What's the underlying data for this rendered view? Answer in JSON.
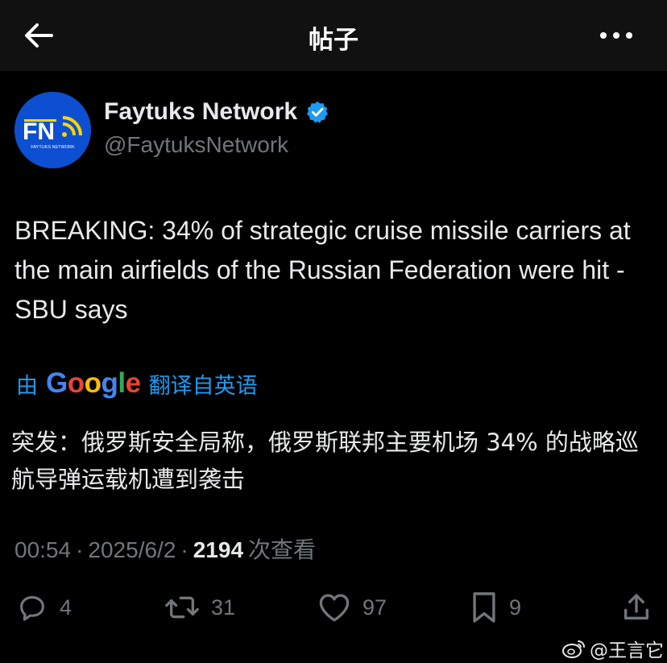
{
  "header": {
    "title": "帖子"
  },
  "author": {
    "name": "Faytuks Network",
    "handle": "@FaytuksNetwork",
    "avatar_logo_text": "FN",
    "avatar_sub_text": "FAYTUKS NETWORK",
    "verified": true
  },
  "post": {
    "text": "BREAKING: 34% of strategic cruise missile carriers at the main airfields of the Russian Federation were hit - SBU says",
    "translate_prefix": "由",
    "translate_brand": "Google",
    "translate_suffix": "翻译自英语",
    "translated_text": "突发：俄罗斯安全局称，俄罗斯联邦主要机场 34% 的战略巡航导弹运载机遭到袭击",
    "time": "00:54",
    "date": "2025/6/2",
    "separator": "·",
    "views_count": "2194",
    "views_label": "次查看"
  },
  "actions": {
    "replies": "4",
    "reposts": "31",
    "likes": "97",
    "bookmarks": "9"
  },
  "watermark": {
    "text": "@王言它"
  },
  "colors": {
    "background": "#000000",
    "header_bg": "#111111",
    "text_primary": "#e7e9ea",
    "text_secondary": "#71767b",
    "accent": "#1d9bf0",
    "avatar_bg": "#0d4fd1"
  }
}
